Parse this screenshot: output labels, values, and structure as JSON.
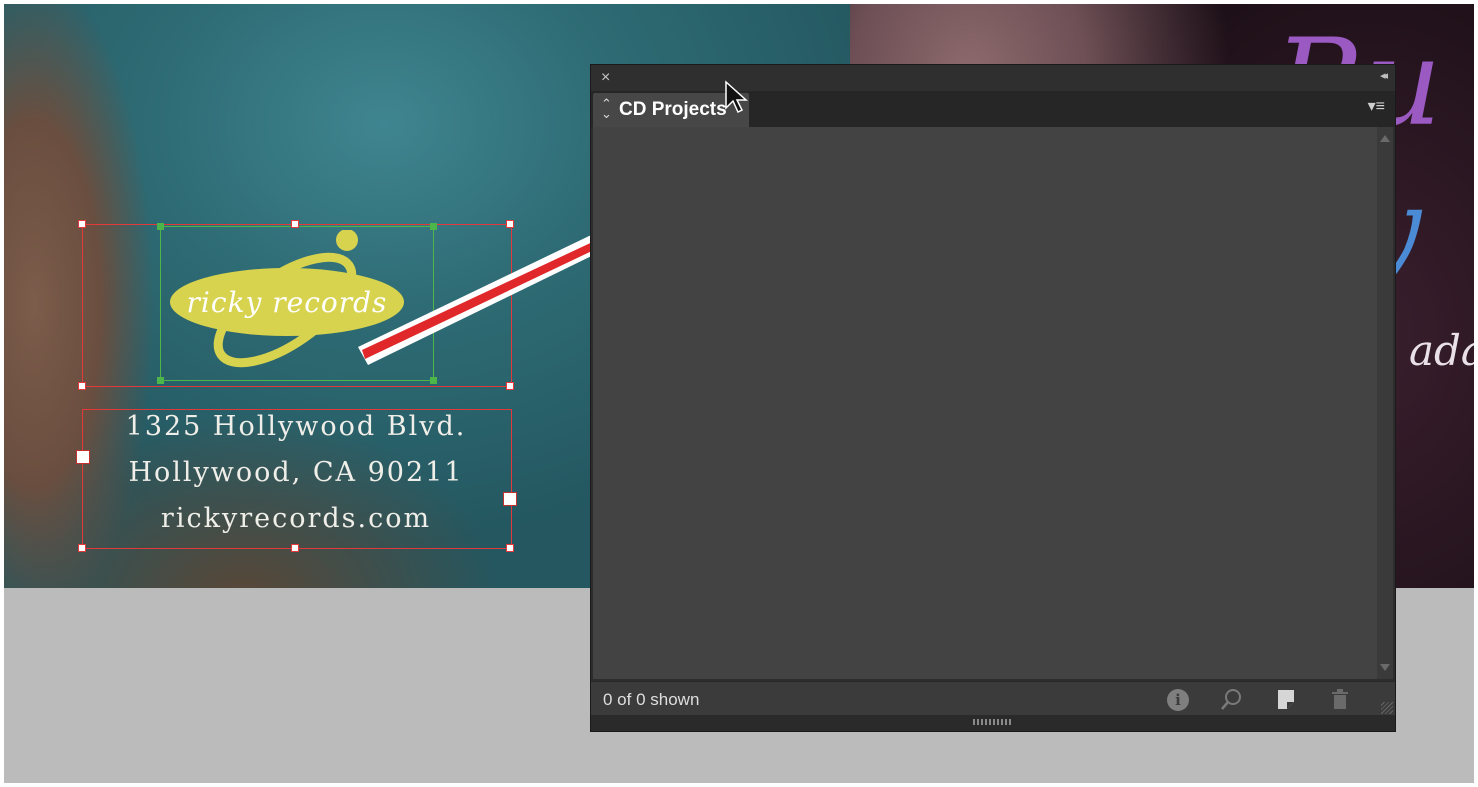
{
  "document": {
    "logo_text": "ricky records",
    "address_lines": [
      "1325 Hollywood Blvd.",
      "Hollywood, CA 90211",
      "rickyrecords.com"
    ],
    "script_fragments": [
      "Ru",
      "y",
      "ada"
    ]
  },
  "panel": {
    "close_symbol": "×",
    "collapse_symbol": "◂◂",
    "tab_arrows": "⌃⌄",
    "tab_label": "CD Projects",
    "menu_symbol": "▾≡",
    "status": "0 of 0 shown",
    "icons": [
      "info-icon",
      "search-icon",
      "new-snippet-icon",
      "trash-icon"
    ]
  },
  "colors": {
    "selection_red": "#e23a3a",
    "selection_green": "#4db64a",
    "arrow_red": "#e0282a",
    "logo_yellow": "#d7d34e"
  }
}
